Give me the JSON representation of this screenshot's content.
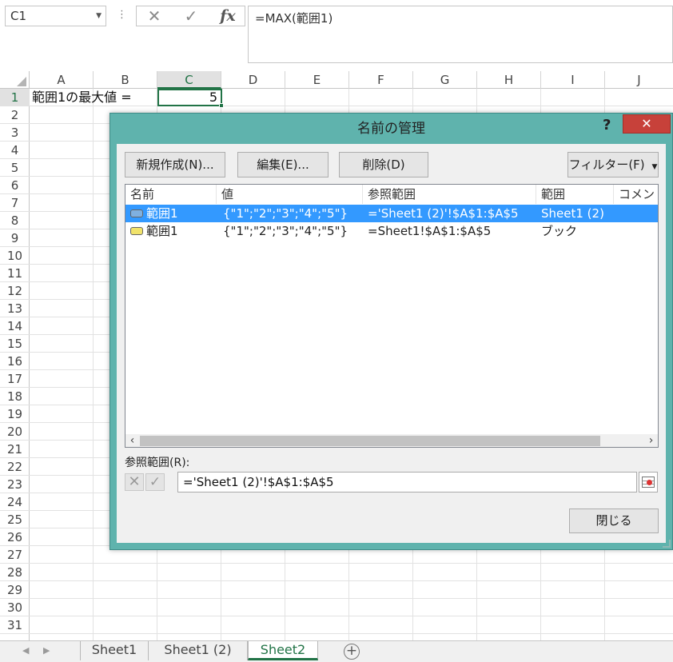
{
  "name_box": "C1",
  "formula_bar": {
    "formula": "=MAX(範囲1)",
    "cancel_glyph": "✕",
    "enter_glyph": "✓",
    "fx_label": "fx",
    "more_glyph": "⋮"
  },
  "columns": [
    "A",
    "B",
    "C",
    "D",
    "E",
    "F",
    "G",
    "H",
    "I",
    "J"
  ],
  "rows": [
    "1",
    "2",
    "3",
    "4",
    "5",
    "6",
    "7",
    "8",
    "9",
    "10",
    "11",
    "12",
    "13",
    "14",
    "15",
    "16",
    "17",
    "18",
    "19",
    "20",
    "21",
    "22",
    "23",
    "24",
    "25",
    "26",
    "27",
    "28",
    "29",
    "30",
    "31"
  ],
  "cells": {
    "a1": "範囲1の最大値 =",
    "c1": "5"
  },
  "sheet_tabs": {
    "items": [
      "Sheet1",
      "Sheet1 (2)",
      "Sheet2"
    ],
    "active": "Sheet2",
    "add_glyph": "+"
  },
  "dialog": {
    "title": "名前の管理",
    "help": "?",
    "close": "✕",
    "buttons": {
      "new": "新規作成(N)...",
      "edit": "編集(E)...",
      "delete": "削除(D)",
      "filter": "フィルター(F)"
    },
    "list": {
      "headers": [
        "名前",
        "値",
        "参照範囲",
        "範囲",
        "コメント"
      ],
      "rows": [
        {
          "name": "範囲1",
          "value": "{\"1\";\"2\";\"3\";\"4\";\"5\"}",
          "refers_to": "='Sheet1 (2)'!$A$1:$A$5",
          "scope": "Sheet1 (2)",
          "comment": "",
          "selected": true,
          "icon": "sheet-scope-name-icon"
        },
        {
          "name": "範囲1",
          "value": "{\"1\";\"2\";\"3\";\"4\";\"5\"}",
          "refers_to": "=Sheet1!$A$1:$A$5",
          "scope": "ブック",
          "comment": "",
          "selected": false,
          "icon": "workbook-scope-name-icon"
        }
      ]
    },
    "refers_label": "参照範囲(R):",
    "refers_value": "='Sheet1 (2)'!$A$1:$A$5",
    "close_button": "閉じる",
    "colors": {
      "title_bar": "#5fb3ad",
      "close_red": "#c7413a",
      "selection": "#3399ff"
    }
  },
  "colors": {
    "excel_green": "#217346",
    "header_selected": "#e1e1e1"
  }
}
